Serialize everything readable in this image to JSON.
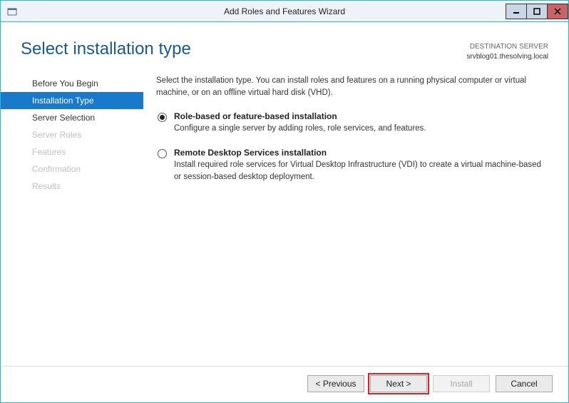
{
  "window": {
    "title": "Add Roles and Features Wizard"
  },
  "header": {
    "page_title": "Select installation type",
    "dest_label": "DESTINATION SERVER",
    "dest_name": "srvblog01.thesolving.local"
  },
  "sidebar": {
    "items": [
      {
        "label": "Before You Begin",
        "state": "normal"
      },
      {
        "label": "Installation Type",
        "state": "active"
      },
      {
        "label": "Server Selection",
        "state": "normal"
      },
      {
        "label": "Server Roles",
        "state": "disabled"
      },
      {
        "label": "Features",
        "state": "disabled"
      },
      {
        "label": "Confirmation",
        "state": "disabled"
      },
      {
        "label": "Results",
        "state": "disabled"
      }
    ]
  },
  "main": {
    "intro": "Select the installation type. You can install roles and features on a running physical computer or virtual machine, or on an offline virtual hard disk (VHD).",
    "options": [
      {
        "title": "Role-based or feature-based installation",
        "desc": "Configure a single server by adding roles, role services, and features.",
        "selected": true
      },
      {
        "title": "Remote Desktop Services installation",
        "desc": "Install required role services for Virtual Desktop Infrastructure (VDI) to create a virtual machine-based or session-based desktop deployment.",
        "selected": false
      }
    ]
  },
  "footer": {
    "previous": "< Previous",
    "next": "Next >",
    "install": "Install",
    "cancel": "Cancel"
  }
}
